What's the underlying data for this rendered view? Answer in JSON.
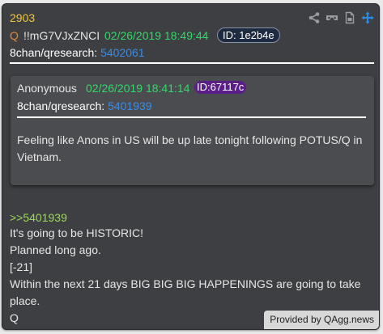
{
  "post": {
    "number": "2903",
    "q_mark": "Q",
    "tripcode": "!!mG7VJxZNCI",
    "date": "02/26/2019 18:49:44",
    "id_badge": "ID: 1e2b4e",
    "board_label": "8chan/qresearch:",
    "board_link": "5402061",
    "reply_ref": ">>5401939",
    "lines": [
      "It's going to be HISTORIC!",
      "Planned long ago.",
      "[-21]",
      "Within the next 21 days BIG BIG BIG HAPPENINGS are going to take",
      "place.",
      "Q"
    ]
  },
  "quoted": {
    "author": "Anonymous",
    "date": "02/26/2019 18:41:14",
    "id_badge": "ID:67117c",
    "board_label": "8chan/qresearch:",
    "board_link": "5401939",
    "text": "Feeling like Anons in US will be up late tonight following POTUS/Q in Vietnam."
  },
  "footer": {
    "provided_by": "Provided by QAgg.news"
  },
  "icons": [
    "share-icon",
    "vr-icon",
    "document-icon",
    "move-icon"
  ],
  "colors": {
    "card_bg": "#3e3f42",
    "post_number": "#f3c537",
    "date": "#32d96a",
    "link": "#3b8ce6",
    "reply_ref": "#9bd85a",
    "quote_id_bg": "#5a1f86"
  }
}
